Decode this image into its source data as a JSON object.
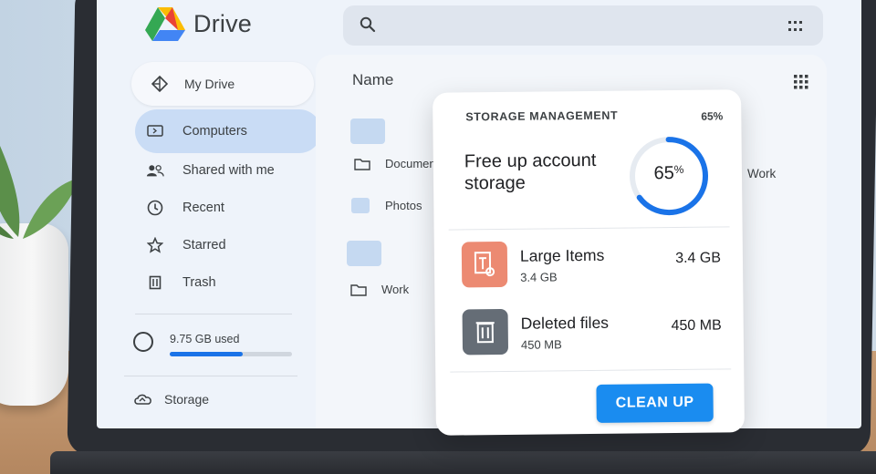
{
  "app": {
    "name": "Drive",
    "logo_icon": "google-drive-logo",
    "colors": {
      "accent": "#1a73e8",
      "button": "#1a8cf0",
      "active_nav": "#c9dcf5"
    }
  },
  "search": {
    "icon": "search-icon",
    "options_icon": "grid-icon"
  },
  "sidebar": {
    "my_drive": "My Drive",
    "items": [
      {
        "label": "Computers",
        "icon": "computer-icon",
        "active": true
      },
      {
        "label": "Shared with me",
        "icon": "people-icon",
        "active": false
      },
      {
        "label": "Recent",
        "icon": "clock-icon",
        "active": false
      },
      {
        "label": "Starred",
        "icon": "star-icon",
        "active": false
      },
      {
        "label": "Trash",
        "icon": "trash-icon",
        "active": false
      }
    ],
    "storage": {
      "used_label": "9.75 GB used",
      "fill_fraction": 0.6
    },
    "storage_link": "Storage"
  },
  "files": {
    "column_header": "Name",
    "rows": [
      {
        "name": "Documents",
        "icon": "folder-icon"
      },
      {
        "name": "Photos",
        "icon": "folder-icon"
      },
      {
        "name": "Work",
        "icon": "folder-icon"
      }
    ],
    "right_label": "Work"
  },
  "storage_card": {
    "title": "STORAGE MANAGEMENT",
    "percent_small": "65%",
    "headline": "Free up account storage",
    "ring_value": "65",
    "ring_unit": "%",
    "ring_fraction": 0.65,
    "items": [
      {
        "name": "Large Items",
        "sub": "3.4 GB",
        "size": "3.4 GB",
        "icon": "large-file-icon",
        "color": "#ec8a72"
      },
      {
        "name": "Deleted files",
        "sub": "450 MB",
        "size": "450 MB",
        "icon": "trash-bin-icon",
        "color": "#656d76"
      }
    ],
    "button_label": "CLEAN UP"
  }
}
